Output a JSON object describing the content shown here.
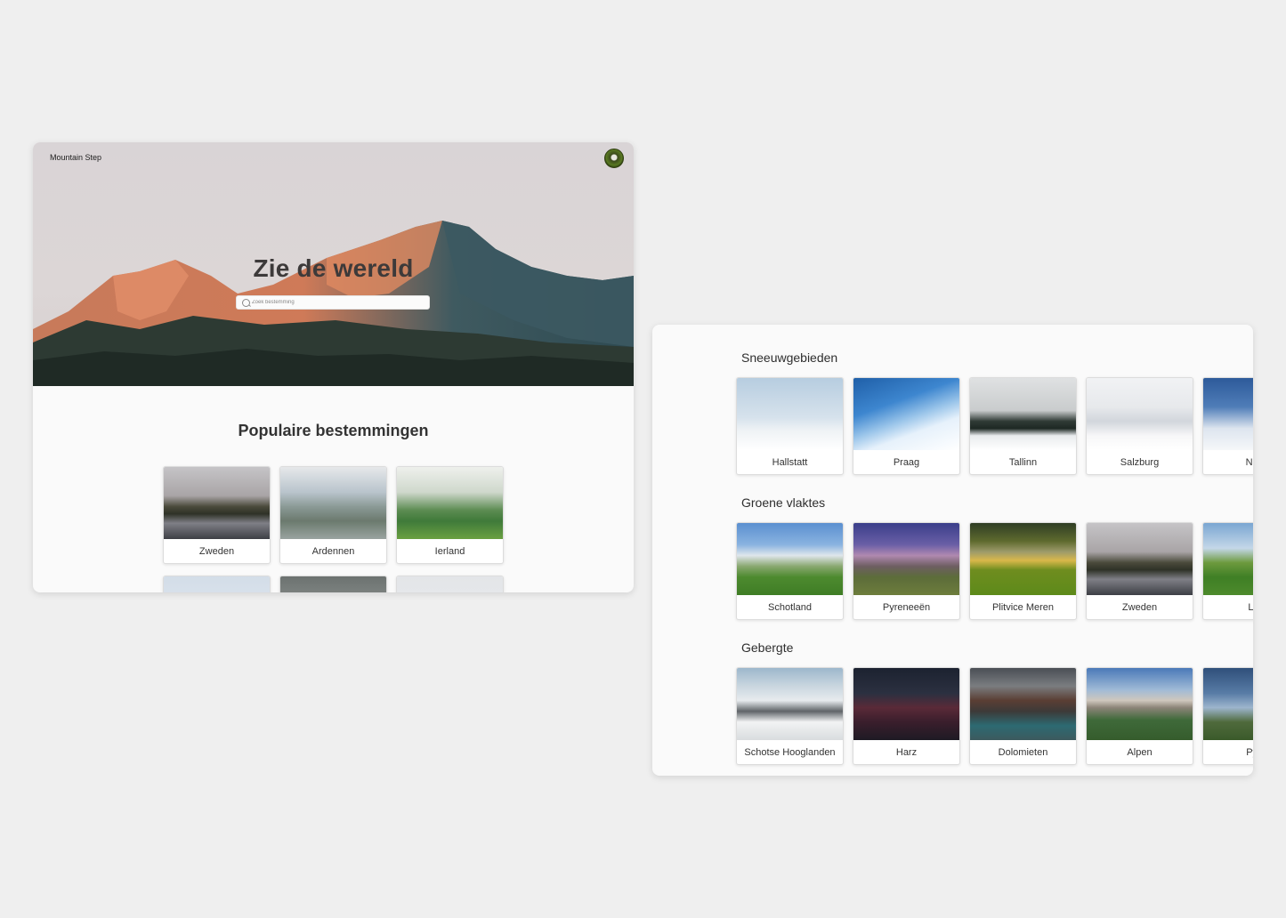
{
  "home": {
    "brand": "Mountain Step",
    "hero_title": "Zie de wereld",
    "search_placeholder": "Zoek bestemming",
    "popular_title": "Populaire bestemmingen",
    "popular": [
      {
        "label": "Zweden"
      },
      {
        "label": "Ardennen"
      },
      {
        "label": "Ierland"
      }
    ]
  },
  "categories": [
    {
      "title": "Sneeuwgebieden",
      "items": [
        "Hallstatt",
        "Praag",
        "Tallinn",
        "Salzburg",
        "Nure"
      ]
    },
    {
      "title": "Groene vlaktes",
      "items": [
        "Schotland",
        "Pyreneeën",
        "Plitvice Meren",
        "Zweden",
        "Lap"
      ]
    },
    {
      "title": "Gebergte",
      "items": [
        "Schotse Hooglanden",
        "Harz",
        "Dolomieten",
        "Alpen",
        "Pyre"
      ]
    }
  ]
}
